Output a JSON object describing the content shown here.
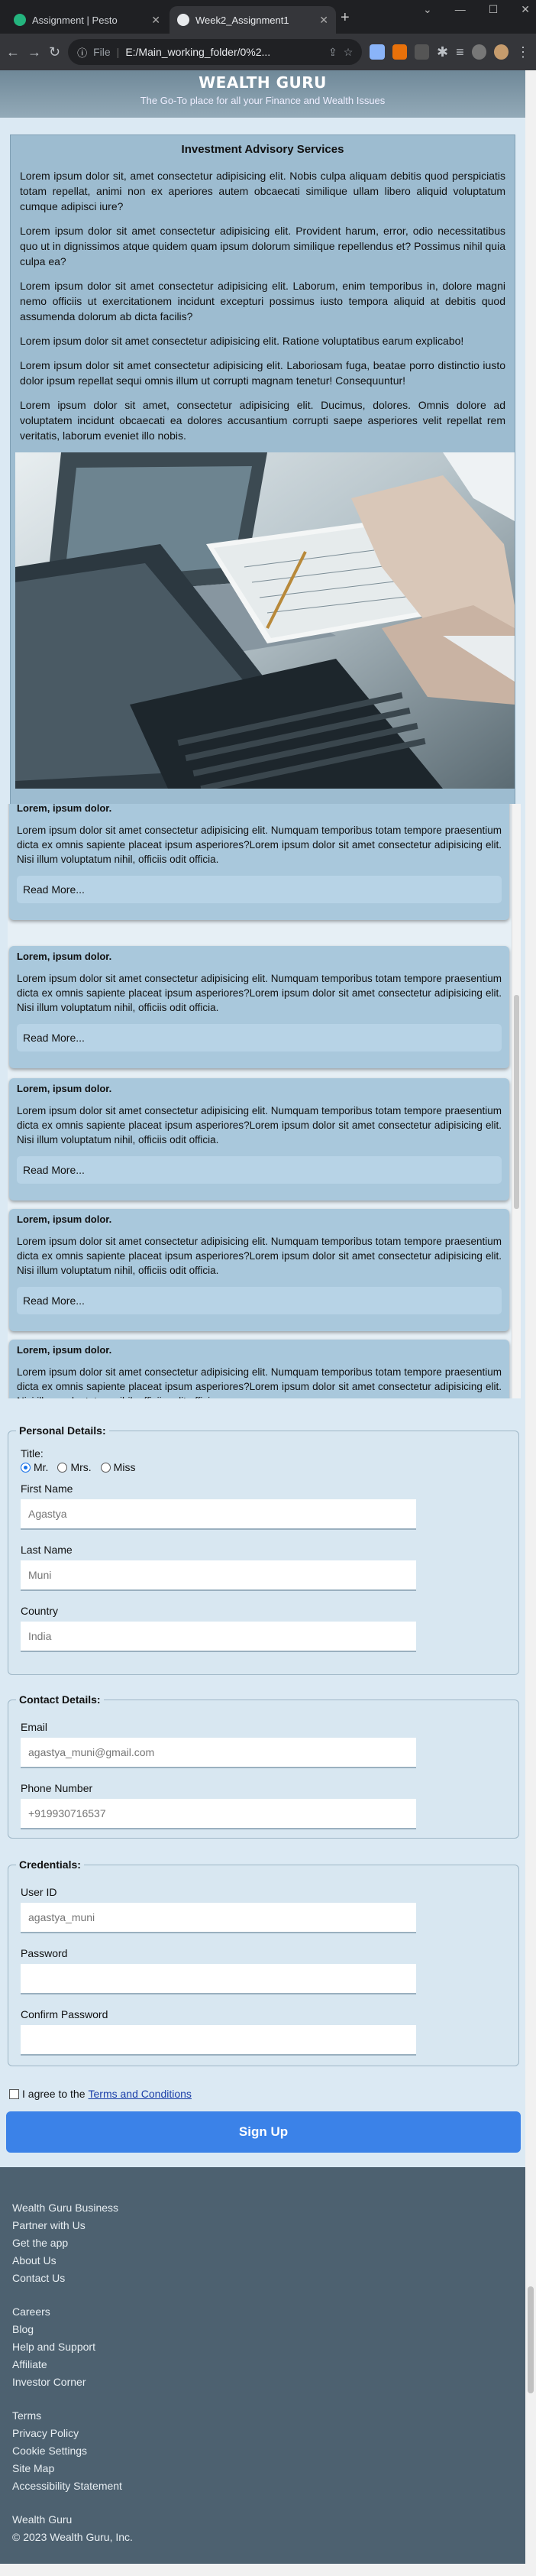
{
  "browser": {
    "tabs": [
      {
        "label": "Assignment | Pesto",
        "active": false
      },
      {
        "label": "Week2_Assignment1",
        "active": true
      }
    ],
    "address_prefix": "File",
    "address": "E:/Main_working_folder/0%2..."
  },
  "header": {
    "title": "WEALTH GURU",
    "tagline": "The Go-To place for all your Finance and Wealth Issues"
  },
  "advisory": {
    "title": "Investment Advisory Services",
    "paragraphs": [
      "Lorem ipsum dolor sit, amet consectetur adipisicing elit. Nobis culpa aliquam debitis quod perspiciatis totam repellat, animi non ex aperiores autem obcaecati similique ullam libero aliquid voluptatum cumque adipisci iure?",
      "Lorem ipsum dolor sit amet consectetur adipisicing elit. Provident harum, error, odio necessitatibus quo ut in dignissimos atque quidem quam ipsum dolorum similique repellendus et? Possimus nihil quia culpa ea?",
      "Lorem ipsum dolor sit amet consectetur adipisicing elit. Laborum, enim temporibus in, dolore magni nemo officiis ut exercitationem incidunt excepturi possimus iusto tempora aliquid at debitis quod assumenda dolorum ab dicta facilis?",
      "Lorem ipsum dolor sit amet consectetur adipisicing elit. Ratione voluptatibus earum explicabo!",
      "Lorem ipsum dolor sit amet consectetur adipisicing elit. Laboriosam fuga, beatae porro distinctio iusto dolor ipsum repellat sequi omnis illum ut corrupti magnam tenetur! Consequuntur!",
      "Lorem ipsum dolor sit amet, consectetur adipisicing elit. Ducimus, dolores. Omnis dolore ad voluptatem incidunt obcaecati ea dolores accusantium corrupti saepe asperiores velit repellat rem veritatis, laborum eveniet illo nobis."
    ]
  },
  "cards": {
    "title": "Lorem, ipsum dolor.",
    "body": "Lorem ipsum dolor sit amet consectetur adipisicing elit. Numquam temporibus totam tempore praesentium dicta ex omnis sapiente placeat ipsum asperiores?Lorem ipsum dolor sit amet consectetur adipisicing elit. Nisi illum voluptatum nihil, officiis odit officia.",
    "button": "Read More..."
  },
  "form": {
    "personal": {
      "legend": "Personal Details:",
      "title_label": "Title:",
      "title_options": [
        "Mr.",
        "Mrs.",
        "Miss"
      ],
      "title_selected": "Mr.",
      "first_name_label": "First Name",
      "first_name_placeholder": "Agastya",
      "last_name_label": "Last Name",
      "last_name_placeholder": "Muni",
      "country_label": "Country",
      "country_placeholder": "India"
    },
    "contact": {
      "legend": "Contact Details:",
      "email_label": "Email",
      "email_placeholder": "agastya_muni@gmail.com",
      "phone_label": "Phone Number",
      "phone_placeholder": "+919930716537"
    },
    "credentials": {
      "legend": "Credentials:",
      "user_label": "User ID",
      "user_placeholder": "agastya_muni",
      "password_label": "Password",
      "confirm_label": "Confirm Password"
    },
    "agree_prefix": "I agree to the",
    "agree_link": "Terms and Conditions",
    "submit": "Sign Up"
  },
  "footer": {
    "group1": [
      "Wealth Guru Business",
      "Partner with Us",
      "Get the app",
      "About Us",
      "Contact Us"
    ],
    "group2": [
      "Careers",
      "Blog",
      "Help and Support",
      "Affiliate",
      "Investor Corner"
    ],
    "group3": [
      "Terms",
      "Privacy Policy",
      "Cookie Settings",
      "Site Map",
      "Accessibility Statement"
    ],
    "group4": [
      "Wealth Guru",
      "© 2023 Wealth Guru, Inc."
    ]
  },
  "colors": {
    "header": "#7f97a6",
    "accent": "#3b82e8",
    "footer": "#4d6170",
    "card": "#a9c8dc"
  }
}
